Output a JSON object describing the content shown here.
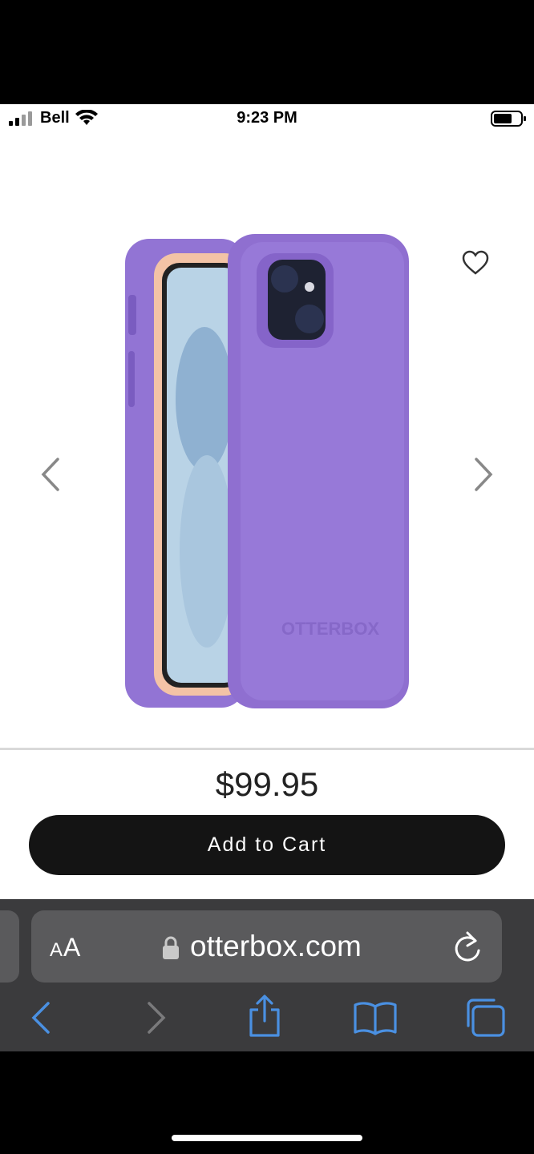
{
  "status_bar": {
    "carrier": "Bell",
    "time": "9:23 PM"
  },
  "product": {
    "price": "$99.95",
    "add_to_cart": "Add to Cart",
    "logo_text": "OTTERBOX"
  },
  "browser": {
    "aa_label": "A",
    "aa_label_big": "A",
    "url": "otterbox.com"
  },
  "colors": {
    "case_purple": "#8f6fd0",
    "case_peach": "#f3c3a6",
    "button": "#141414",
    "toolbar_icons": "#4a90e2"
  }
}
